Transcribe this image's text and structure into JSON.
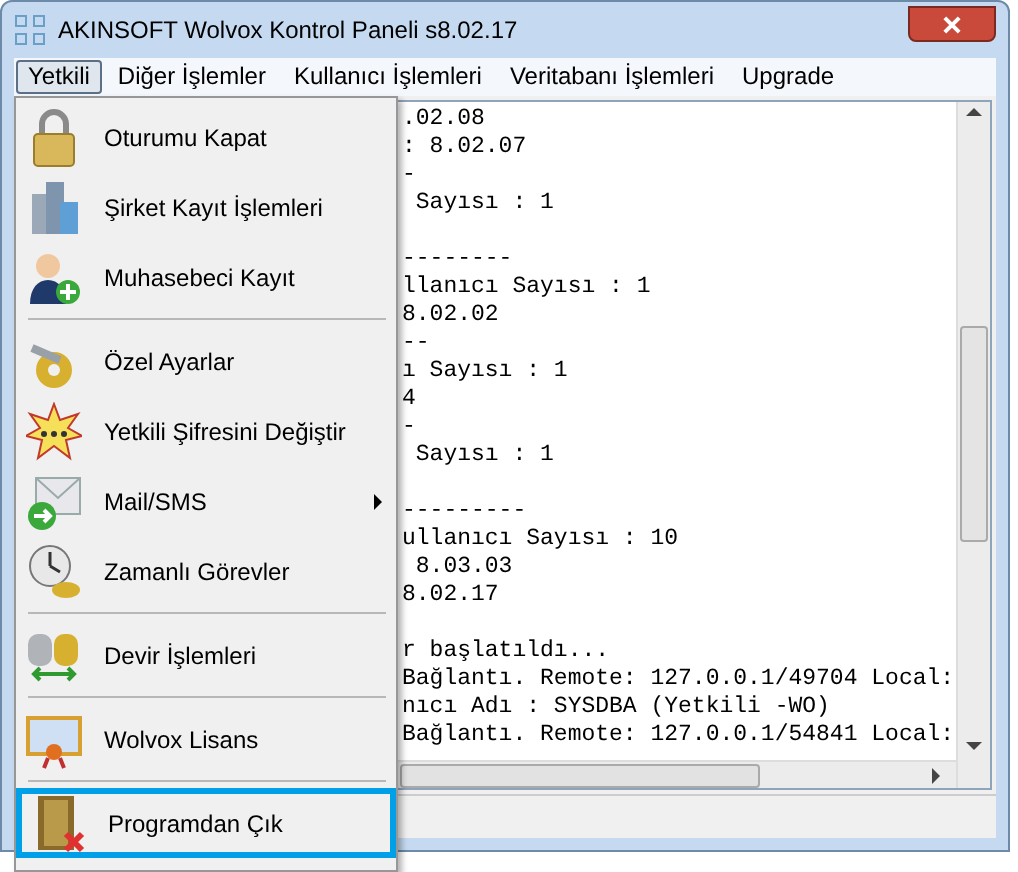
{
  "window": {
    "title": "AKINSOFT Wolvox Kontrol Paneli s8.02.17"
  },
  "menu_bar": [
    {
      "label": "Yetkili",
      "selected": true
    },
    {
      "label": "Diğer İşlemler",
      "selected": false
    },
    {
      "label": "Kullanıcı İşlemleri",
      "selected": false
    },
    {
      "label": "Veritabanı İşlemleri",
      "selected": false
    },
    {
      "label": "Upgrade",
      "selected": false
    }
  ],
  "log_blocks": [
    [
      ".02.08",
      ": 8.02.07",
      "-",
      " Sayısı : 1"
    ],
    [
      "--------",
      "llanıcı Sayısı : 1",
      "8.02.02",
      "--",
      "ı Sayısı : 1",
      "4",
      "-",
      " Sayısı : 1"
    ],
    [
      "---------",
      "ullanıcı Sayısı : 10",
      " 8.03.03",
      "8.02.17"
    ],
    [
      "r başlatıldı...",
      "Bağlantı. Remote: 127.0.0.1/49704 Local:",
      "nıcı Adı : SYSDBA (Yetkili -WO)",
      "Bağlantı. Remote: 127.0.0.1/54841 Local:"
    ]
  ],
  "dropdown_groups": [
    [
      {
        "label": "Oturumu Kapat",
        "submenu": false,
        "selected": false
      },
      {
        "label": "Şirket Kayıt İşlemleri",
        "submenu": false,
        "selected": false
      },
      {
        "label": "Muhasebeci Kayıt",
        "submenu": false,
        "selected": false
      }
    ],
    [
      {
        "label": "Özel Ayarlar",
        "submenu": false,
        "selected": false
      },
      {
        "label": "Yetkili Şifresini Değiştir",
        "submenu": false,
        "selected": false
      },
      {
        "label": "Mail/SMS",
        "submenu": true,
        "selected": false
      },
      {
        "label": "Zamanlı Görevler",
        "submenu": false,
        "selected": false
      }
    ],
    [
      {
        "label": "Devir İşlemleri",
        "submenu": false,
        "selected": false
      }
    ],
    [
      {
        "label": "Wolvox Lisans",
        "submenu": false,
        "selected": false
      }
    ],
    [
      {
        "label": "Programdan Çık",
        "submenu": false,
        "selected": true
      }
    ]
  ]
}
